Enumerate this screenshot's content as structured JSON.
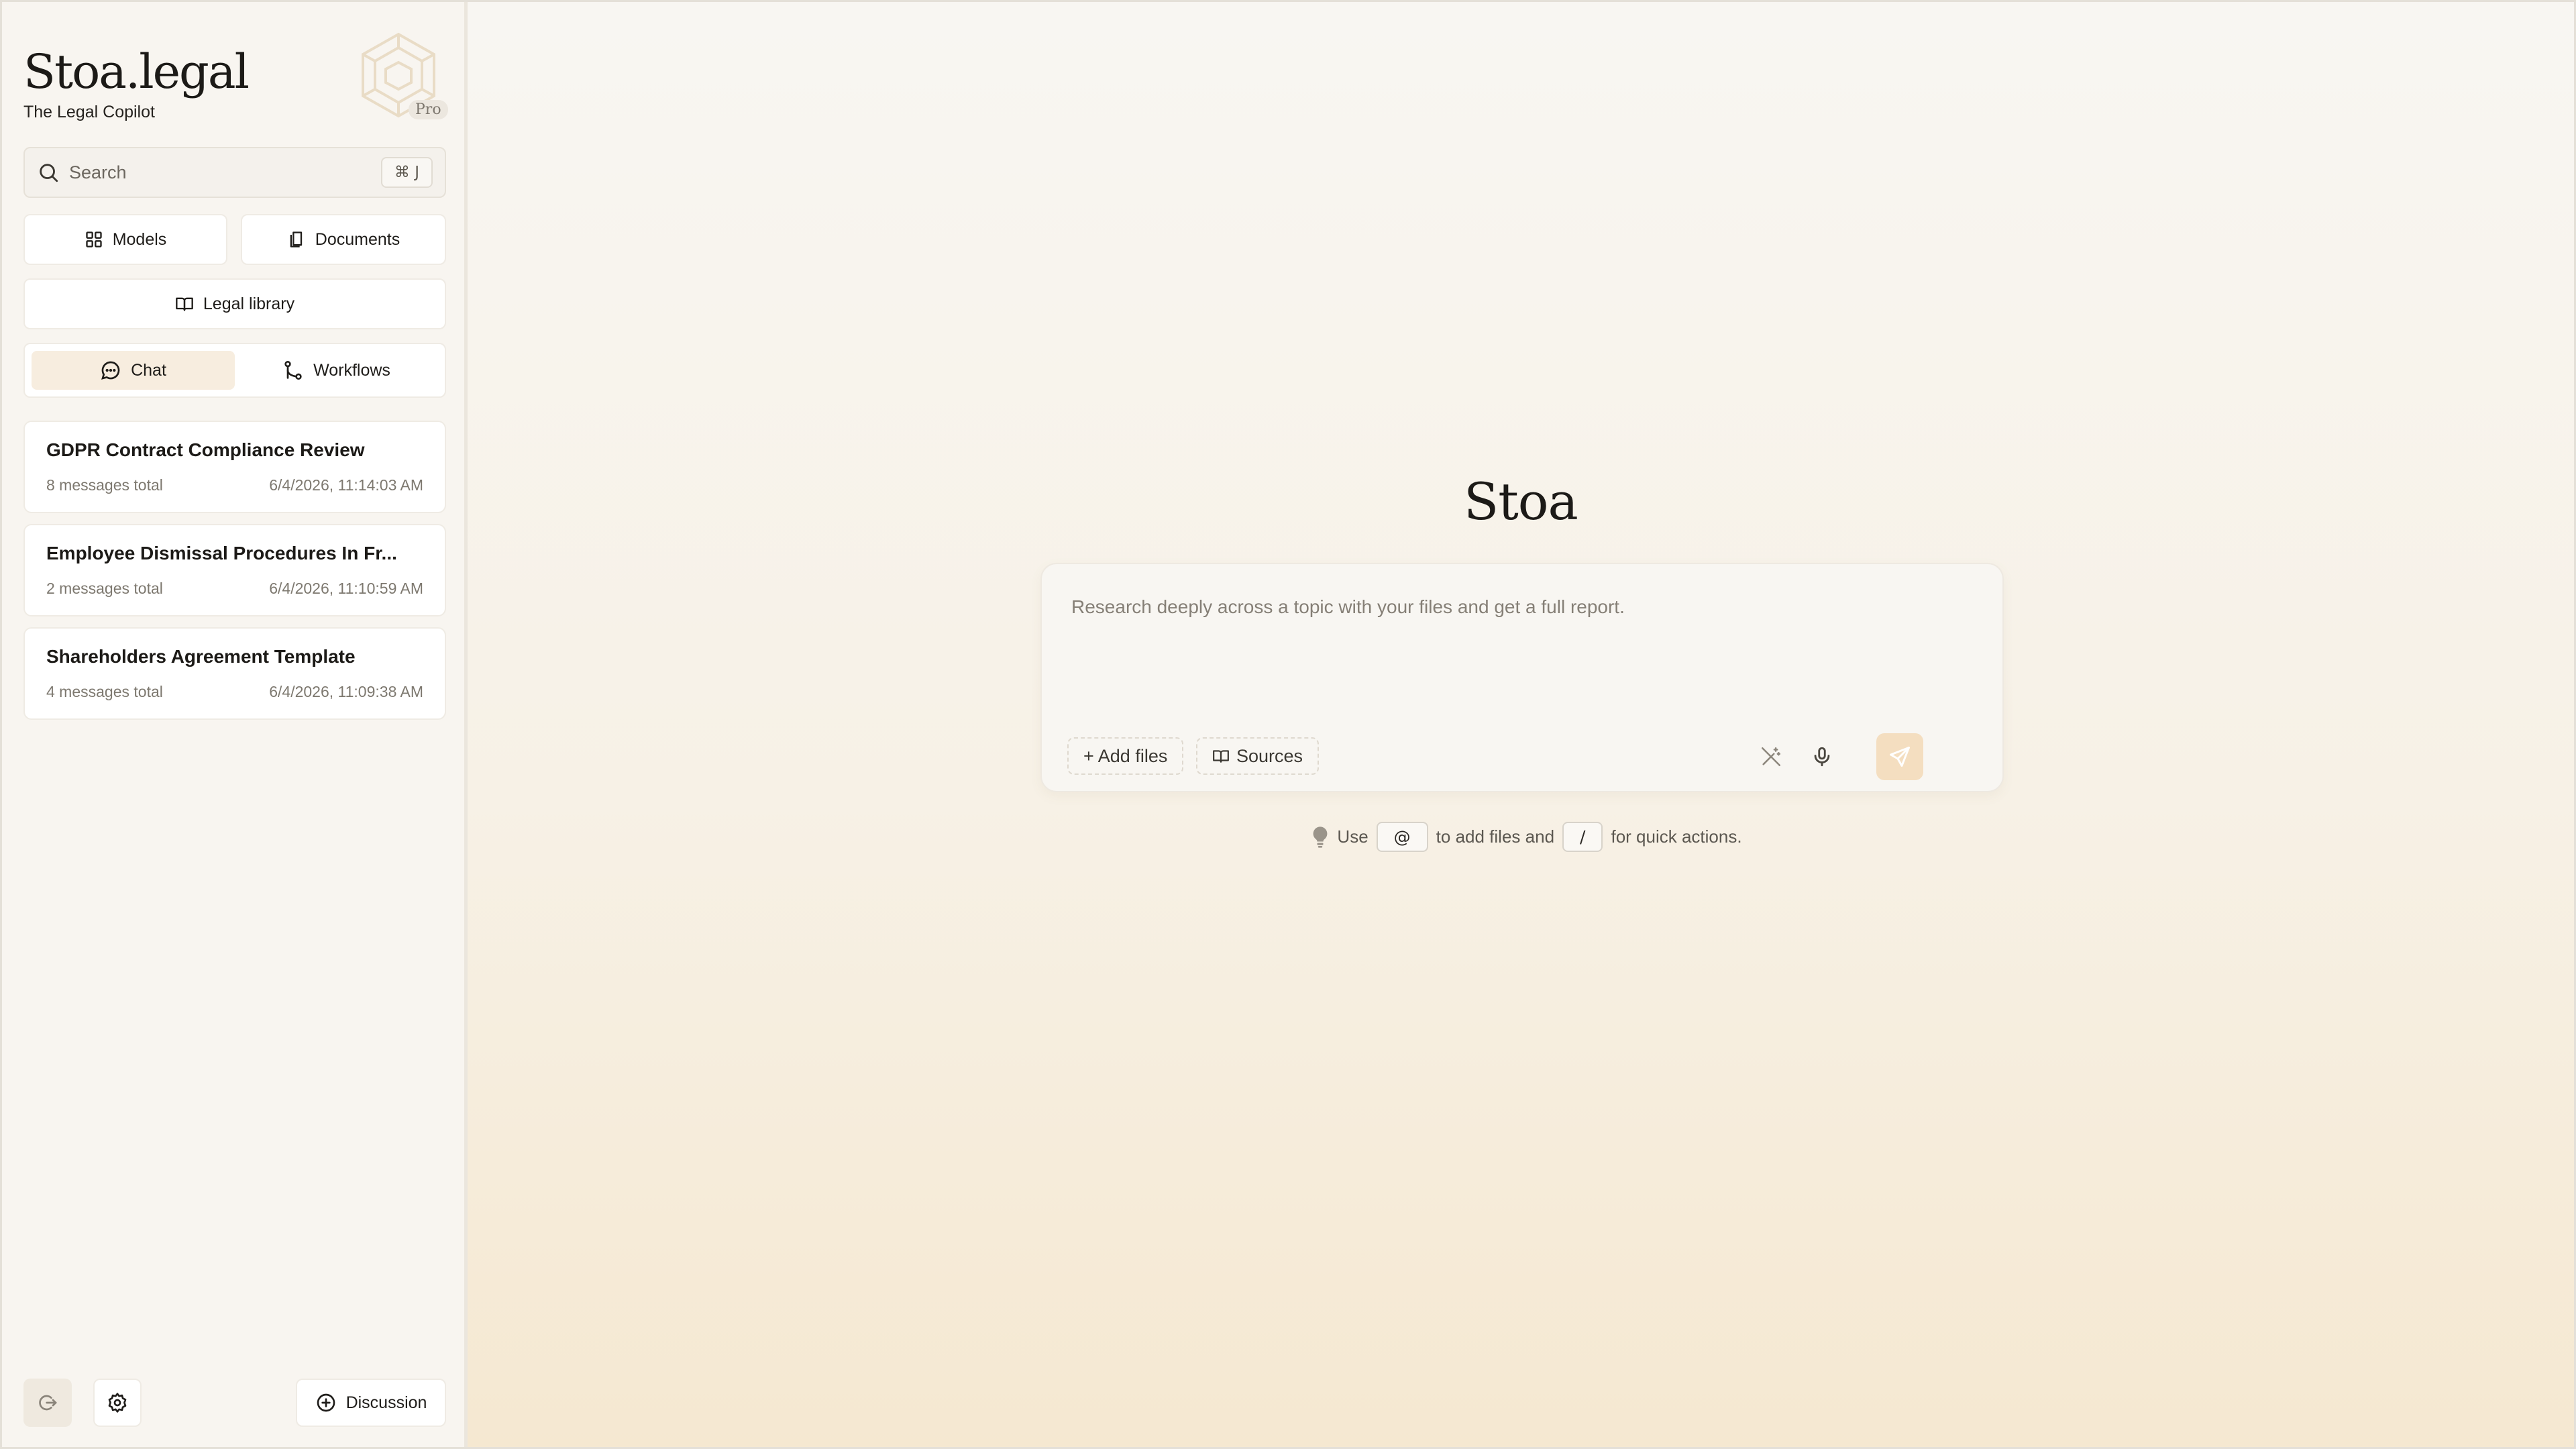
{
  "brand": {
    "title": "Stoa.legal",
    "subtitle": "The Legal Copilot",
    "badge": "Pro",
    "logo_icon": "hexagon-logo-icon"
  },
  "search": {
    "placeholder": "Search",
    "shortcut": "⌘ J"
  },
  "nav": {
    "models_label": "Models",
    "documents_label": "Documents",
    "library_label": "Legal library"
  },
  "tabs": {
    "chat_label": "Chat",
    "workflows_label": "Workflows",
    "active": "Chat"
  },
  "conversations": [
    {
      "title": "GDPR Contract Compliance Review",
      "count": "8 messages total",
      "timestamp": "6/4/2026, 11:14:03 AM"
    },
    {
      "title": "Employee Dismissal Procedures In Fr...",
      "count": "2 messages total",
      "timestamp": "6/4/2026, 11:10:59 AM"
    },
    {
      "title": "Shareholders Agreement Template",
      "count": "4 messages total",
      "timestamp": "6/4/2026, 11:09:38 AM"
    }
  ],
  "footer": {
    "discussion_label": "Discussion"
  },
  "main": {
    "title": "Stoa",
    "composer_placeholder": "Research deeply across a topic with your files and get a full report.",
    "add_files_label": "+ Add files",
    "sources_label": "Sources",
    "hint": {
      "use": "Use",
      "at_key": "@",
      "mid": "to add files and",
      "slash_key": "/",
      "end": "for quick actions."
    }
  },
  "colors": {
    "accent": "#f4dec0",
    "active_tab": "#f7eddf",
    "sidebar_bg": "#f8f5f0"
  }
}
